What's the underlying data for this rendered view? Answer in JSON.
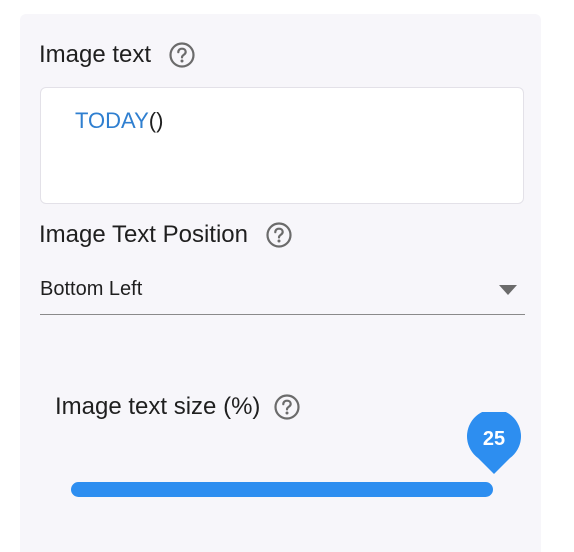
{
  "image_text": {
    "label": "Image text",
    "value_function": "TODAY",
    "value_parens": "()"
  },
  "text_position": {
    "label": "Image Text Position",
    "selected": "Bottom Left"
  },
  "text_size": {
    "label": "Image text size (%)",
    "value": "25",
    "value_numeric": 25,
    "max": 25
  },
  "icons": {
    "help": "help-circle-icon",
    "dropdown": "chevron-down-icon"
  },
  "colors": {
    "accent": "#2d8ef0",
    "formula_function": "#2f7fd0",
    "panel_background": "#f7f6fa"
  }
}
